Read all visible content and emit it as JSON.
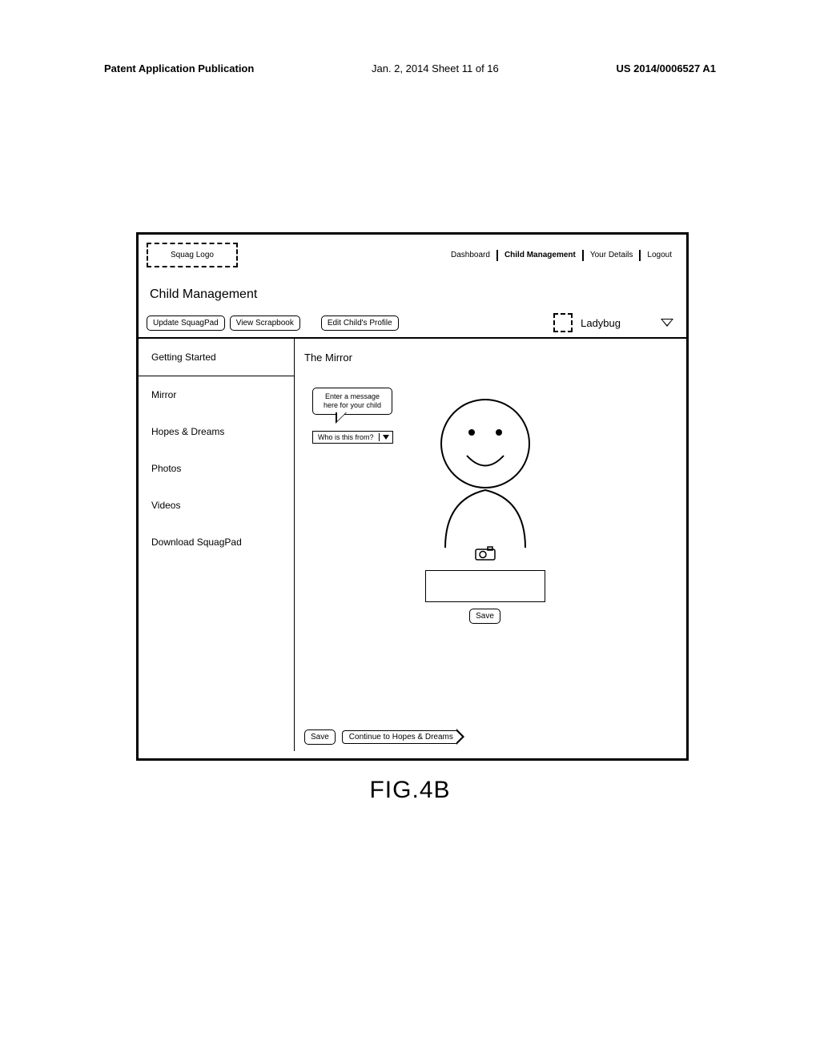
{
  "doc_header": {
    "left": "Patent Application Publication",
    "center": "Jan. 2, 2014  Sheet 11 of 16",
    "right": "US 2014/0006527 A1"
  },
  "logo_text": "Squag Logo",
  "nav": {
    "dashboard": "Dashboard",
    "child_mgmt": "Child Management",
    "your_details": "Your Details",
    "logout": "Logout"
  },
  "page_title": "Child Management",
  "toolbar": {
    "update_squagpad": "Update SquagPad",
    "view_scrapbook": "View Scrapbook",
    "edit_profile": "Edit Child's Profile"
  },
  "selected_child": "Ladybug",
  "sidebar": {
    "items": [
      "Getting Started",
      "Mirror",
      "Hopes & Dreams",
      "Photos",
      "Videos",
      "Download SquagPad"
    ]
  },
  "section_heading": "The Mirror",
  "bubble_line1": "Enter a message",
  "bubble_line2": "here for your child",
  "from_select_label": "Who is this from?",
  "save_label": "Save",
  "continue_label": "Continue to Hopes & Dreams",
  "figure_label": "FIG.4B"
}
